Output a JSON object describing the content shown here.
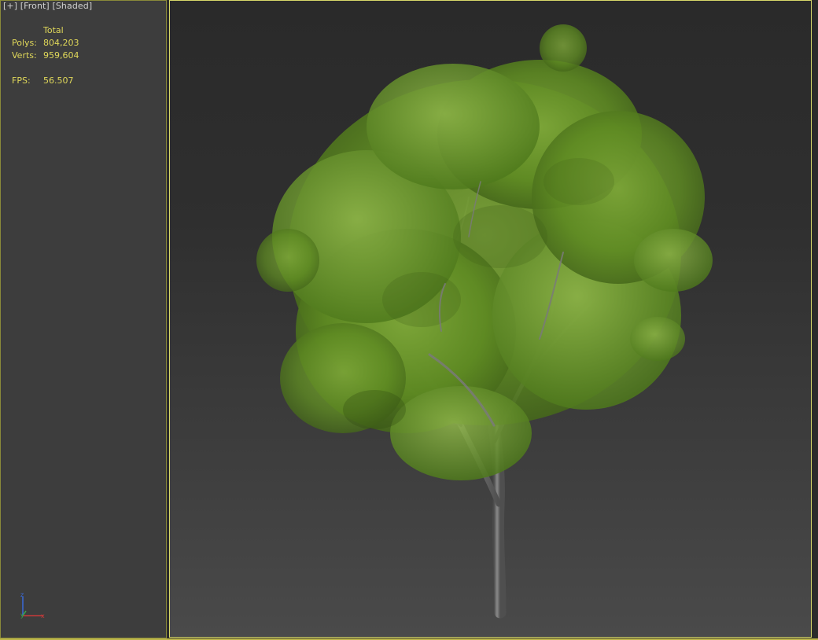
{
  "viewport": {
    "labels": [
      "[+]",
      "[Front]",
      "[Shaded]"
    ]
  },
  "stats": {
    "header": "Total",
    "polys_label": "Polys:",
    "polys_value": "804,203",
    "verts_label": "Verts:",
    "verts_value": "959,604",
    "fps_label": "FPS:",
    "fps_value": "56.507"
  },
  "gizmo": {
    "z": "z",
    "y": "y",
    "x": "x"
  },
  "colors": {
    "stats_text": "#e0d85a",
    "active_border": "#d8d86a",
    "foliage": "#6a8f2a",
    "trunk": "#6e6e6e"
  },
  "icons": [
    "axis-gizmo-icon",
    "tree-model"
  ]
}
